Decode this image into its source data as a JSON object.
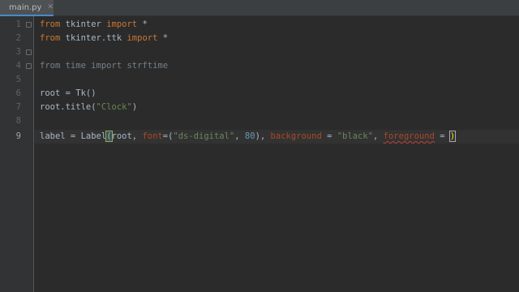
{
  "tab": {
    "filename": "main.py",
    "icon": "python-file-icon"
  },
  "gutter": {
    "line_numbers": [
      "1",
      "2",
      "3",
      "4",
      "5",
      "6",
      "7",
      "8",
      "9"
    ],
    "active_line": "9"
  },
  "code": {
    "line1": {
      "kw1": "from",
      "mod": " tkinter ",
      "kw2": "import",
      "rest": " *"
    },
    "line2": {
      "kw1": "from",
      "mod": " tkinter.ttk ",
      "kw2": "import",
      "rest": " *"
    },
    "line4": {
      "text": "from time import strftime"
    },
    "line6": {
      "text": "root = Tk()"
    },
    "line7": {
      "prefix": "root.title(",
      "str": "\"Clock\"",
      "suffix": ")"
    },
    "line9": {
      "t1": "label = Label",
      "p1": "(",
      "t2": "root, ",
      "param1": "font",
      "t3": "=(",
      "str1": "\"ds-digital\"",
      "t4": ", ",
      "num1": "80",
      "t5": "), ",
      "param2": "background",
      "t6": " = ",
      "str2": "\"black\"",
      "t7": ", ",
      "param3": "foreground",
      "t8": " = ",
      "p2": ")"
    }
  },
  "colors": {
    "background": "#2b2b2b",
    "gutter": "#313335",
    "keyword": "#cc7832",
    "string": "#6a8759",
    "number": "#6897bb",
    "parameter": "#aa4926",
    "text": "#a9b7c6"
  }
}
